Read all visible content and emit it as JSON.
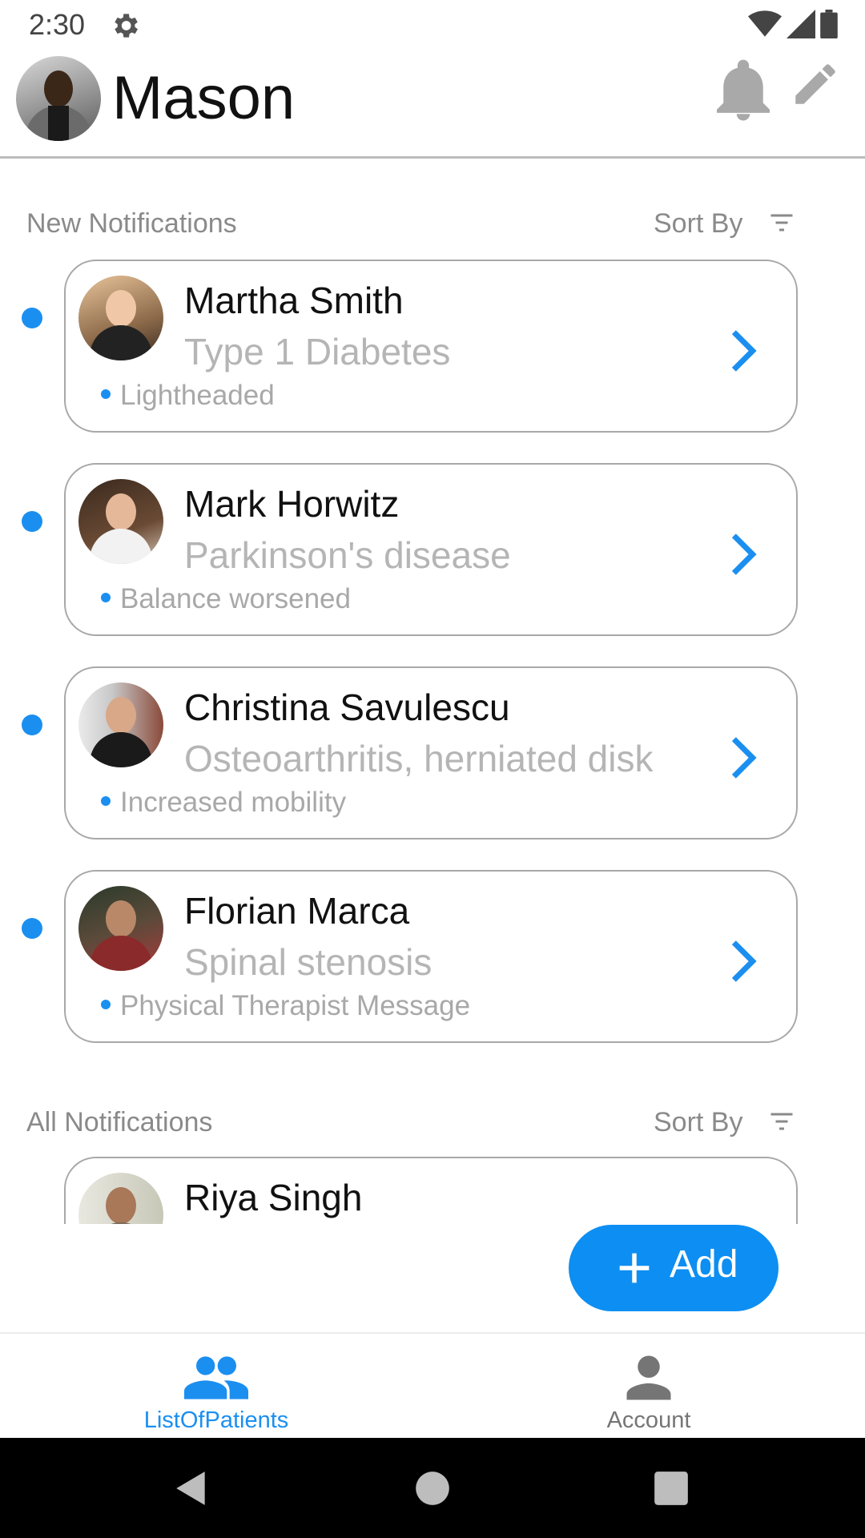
{
  "status_bar": {
    "time": "2:30",
    "icons": [
      "gear-icon",
      "wifi-icon",
      "signal-icon",
      "battery-icon"
    ]
  },
  "header": {
    "user_name": "Mason",
    "actions": [
      "bell-icon",
      "pencil-icon"
    ]
  },
  "new_notifications": {
    "title": "New Notifications",
    "sort_label": "Sort By",
    "items": [
      {
        "name": "Martha Smith",
        "condition": "Type 1 Diabetes",
        "note": "Lightheaded",
        "unread": true
      },
      {
        "name": "Mark Horwitz",
        "condition": "Parkinson's disease",
        "note": "Balance worsened",
        "unread": true
      },
      {
        "name": "Christina Savulescu",
        "condition": "Osteoarthritis, herniated disk",
        "note": "Increased mobility",
        "unread": true
      },
      {
        "name": "Florian Marca",
        "condition": "Spinal stenosis",
        "note": "Physical Therapist Message",
        "unread": true
      }
    ]
  },
  "all_notifications": {
    "title": "All Notifications",
    "sort_label": "Sort By",
    "items": [
      {
        "name": "Riya Singh"
      }
    ]
  },
  "fab": {
    "label": "Add"
  },
  "bottom_nav": {
    "items": [
      {
        "label": "ListOfPatients",
        "icon": "people-icon",
        "active": true
      },
      {
        "label": "Account",
        "icon": "person-icon",
        "active": false
      }
    ]
  },
  "colors": {
    "accent": "#0d8ef2",
    "unread_dot": "#1b8ff0",
    "muted_text": "#8a8a8a",
    "condition_text": "#b5b5b5",
    "inactive_icon": "#757575"
  }
}
